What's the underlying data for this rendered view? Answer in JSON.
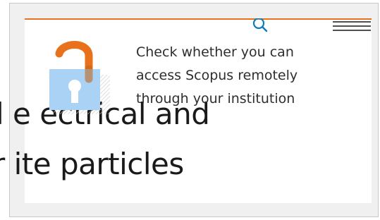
{
  "background_heading": {
    "line1": "l e ectrical and",
    "line2": "r ite particles"
  },
  "popup": {
    "message": "Check whether you can access Scopus remotely through your institution"
  },
  "icons": {
    "search": "search-icon",
    "menu": "hamburger-menu-icon",
    "lock": "open-padlock-icon"
  },
  "colors": {
    "accent_orange": "#e9711c",
    "search_blue": "#0c7dbb",
    "lock_body": "#a9d2f5",
    "text": "#2e2e2e"
  }
}
